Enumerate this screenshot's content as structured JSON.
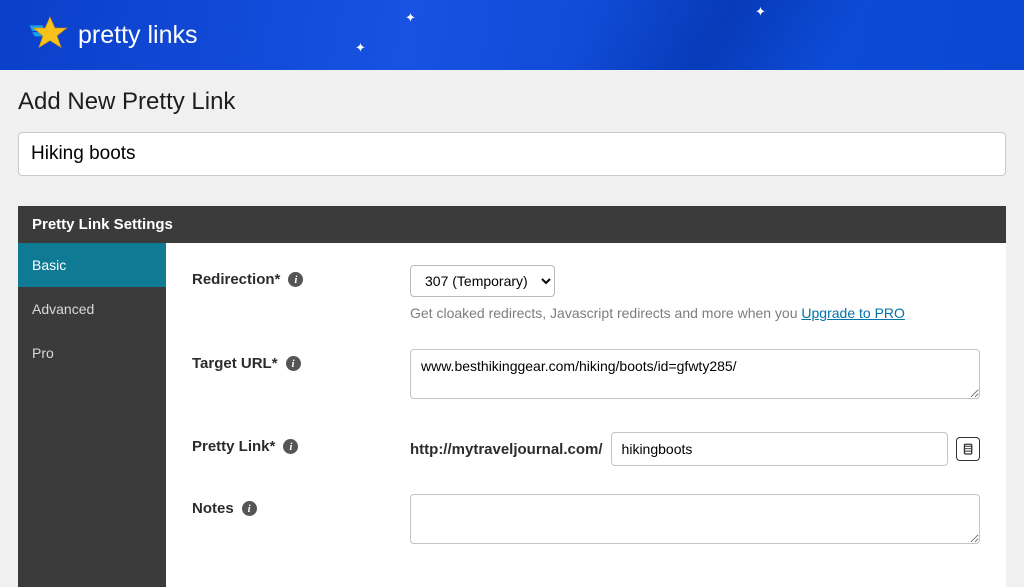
{
  "logo_text": "pretty links",
  "page_title": "Add New Pretty Link",
  "title_value": "Hiking boots",
  "settings_header": "Pretty Link Settings",
  "tabs": {
    "basic": "Basic",
    "advanced": "Advanced",
    "pro": "Pro"
  },
  "fields": {
    "redirection": {
      "label": "Redirection*",
      "value": "307 (Temporary)",
      "hint_pre": "Get cloaked redirects, Javascript redirects and more when you ",
      "hint_link": "Upgrade to PRO"
    },
    "target_url": {
      "label": "Target URL*",
      "value": "www.besthikinggear.com/hiking/boots/id=gfwty285/"
    },
    "pretty_link": {
      "label": "Pretty Link*",
      "prefix": "http://mytraveljournal.com/",
      "slug": "hikingboots"
    },
    "notes": {
      "label": "Notes",
      "value": ""
    }
  }
}
